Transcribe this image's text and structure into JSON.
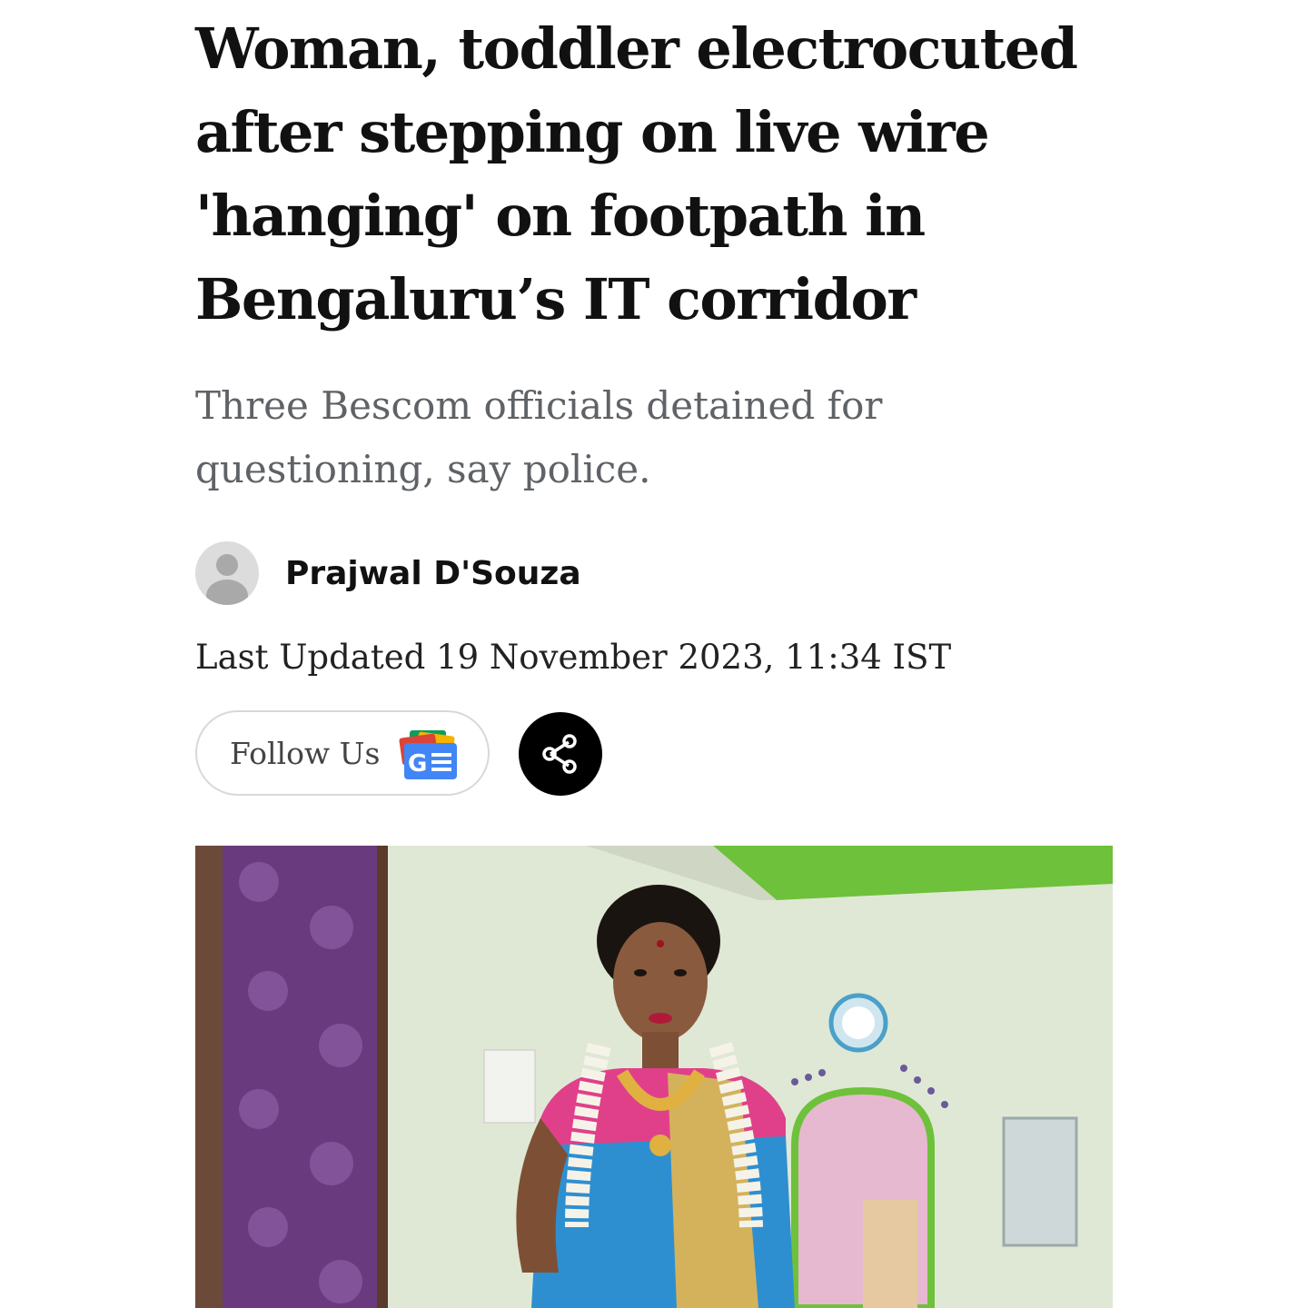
{
  "article": {
    "headline_lines": [
      "Woman, toddler electrocuted",
      "after stepping on live wire",
      "'hanging' on footpath in",
      "Bengaluru’s IT corridor"
    ],
    "subheadline_lines": [
      "Three Bescom officials detained for",
      "questioning, say police."
    ],
    "author": {
      "name": "Prajwal D'Souza"
    },
    "last_updated": "Last Updated 19 November 2023, 11:34 IST",
    "follow_button": {
      "label": "Follow Us",
      "icon": "google-news-icon"
    },
    "share_button": {
      "icon": "share-icon"
    },
    "photo": {
      "description_visible": false
    }
  },
  "colors": {
    "headline": "#111111",
    "subheadline": "#5f6266",
    "share_bg": "#000000",
    "wall": "#dfe8d4",
    "ceiling_trim": "#6ec13a",
    "curtain": "#6a3a7e",
    "saree_blue": "#2e8fd0",
    "saree_gold": "#d4b25c",
    "blouse_pink": "#e0408a"
  }
}
